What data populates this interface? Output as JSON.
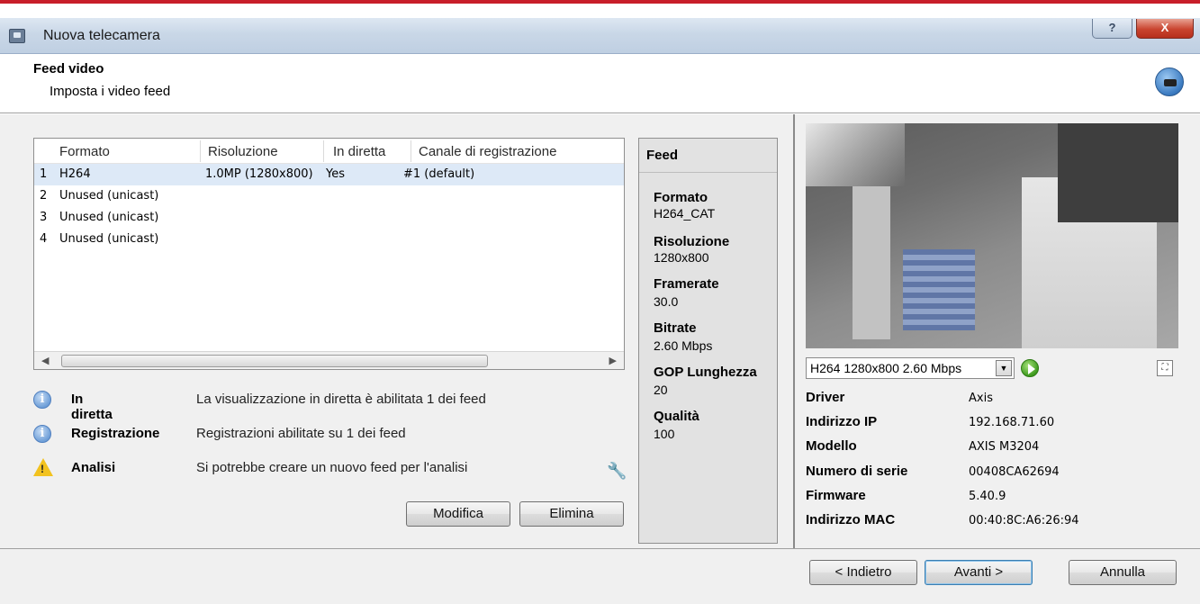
{
  "window": {
    "title": "Nuova telecamera",
    "help_glyph": "?",
    "close_glyph": "X"
  },
  "header": {
    "title": "Feed video",
    "subtitle": "Imposta i video feed"
  },
  "feeds_table": {
    "columns": [
      "Formato",
      "Risoluzione",
      "In diretta",
      "Canale di registrazione"
    ],
    "rows": [
      {
        "index": "1",
        "format": "H264",
        "resolution": "1.0MP (1280x800)",
        "live": "Yes",
        "channel": "#1 (default)"
      },
      {
        "index": "2",
        "format": "Unused (unicast)",
        "resolution": "",
        "live": "",
        "channel": ""
      },
      {
        "index": "3",
        "format": "Unused (unicast)",
        "resolution": "",
        "live": "",
        "channel": ""
      },
      {
        "index": "4",
        "format": "Unused (unicast)",
        "resolution": "",
        "live": "",
        "channel": ""
      }
    ],
    "selected_index": 0
  },
  "notices": [
    {
      "icon": "info-icon",
      "label": "In diretta",
      "text": "La visualizzazione in diretta è abilitata 1 dei feed"
    },
    {
      "icon": "info-icon",
      "label": "Registrazione",
      "text": "Registrazioni abilitate su 1 dei feed"
    },
    {
      "icon": "warning-icon",
      "label": "Analisi",
      "text": "Si potrebbe creare un nuovo feed per l'analisi"
    }
  ],
  "buttons": {
    "edit": "Modifica",
    "delete": "Elimina",
    "back": "< Indietro",
    "next": "Avanti >",
    "cancel": "Annulla"
  },
  "feed_panel": {
    "title": "Feed",
    "fields": [
      {
        "label": "Formato",
        "value": "H264_CAT"
      },
      {
        "label": "Risoluzione",
        "value": "1280x800"
      },
      {
        "label": "Framerate",
        "value": "30.0"
      },
      {
        "label": "Bitrate",
        "value": "2.60 Mbps"
      },
      {
        "label": "GOP Lunghezza",
        "value": "20"
      },
      {
        "label": "Qualità",
        "value": "100"
      }
    ]
  },
  "preview": {
    "stream_selected": "H264 1280x800 2.60 Mbps"
  },
  "camera_info": [
    {
      "key": "Driver",
      "value": "Axis"
    },
    {
      "key": "Indirizzo IP",
      "value": "192.168.71.60"
    },
    {
      "key": "Modello",
      "value": "AXIS M3204"
    },
    {
      "key": "Numero di serie",
      "value": "00408CA62694"
    },
    {
      "key": "Firmware",
      "value": "5.40.9"
    },
    {
      "key": "Indirizzo MAC",
      "value": "00:40:8C:A6:26:94"
    }
  ],
  "colors": {
    "accent_line": "#c81e2a",
    "selection": "#dde9f7"
  }
}
